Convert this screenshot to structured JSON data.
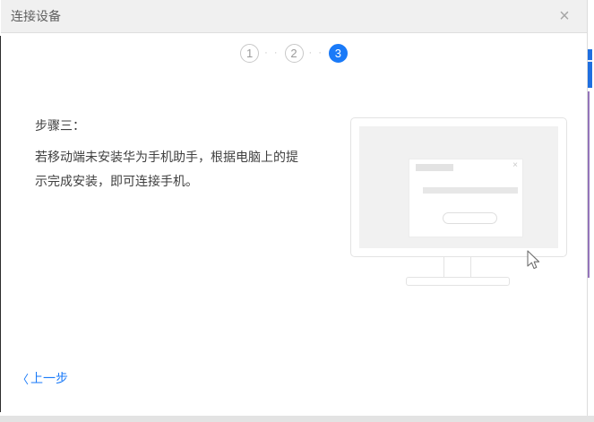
{
  "window": {
    "title": "连接设备",
    "close_label": "×"
  },
  "stepper": {
    "separator": "· ·",
    "steps": [
      {
        "label": "1",
        "state": "inactive"
      },
      {
        "label": "2",
        "state": "inactive"
      },
      {
        "label": "3",
        "state": "active"
      }
    ]
  },
  "content": {
    "heading": "步骤三：",
    "body": "若移动端未安装华为手机助手，根据电脑上的提示完成安装，即可连接手机。"
  },
  "illustration": {
    "mock_close_label": "×"
  },
  "footer": {
    "back_chevron": "〈",
    "back_label": "上一步"
  },
  "colors": {
    "accent_blue": "#1a7af8",
    "titlebar_gray": "#f0f0f0",
    "edge_purple_strip": "#9474ba",
    "edge_blue_fragment": "#1f6fe0",
    "text_dark": "#404040"
  }
}
